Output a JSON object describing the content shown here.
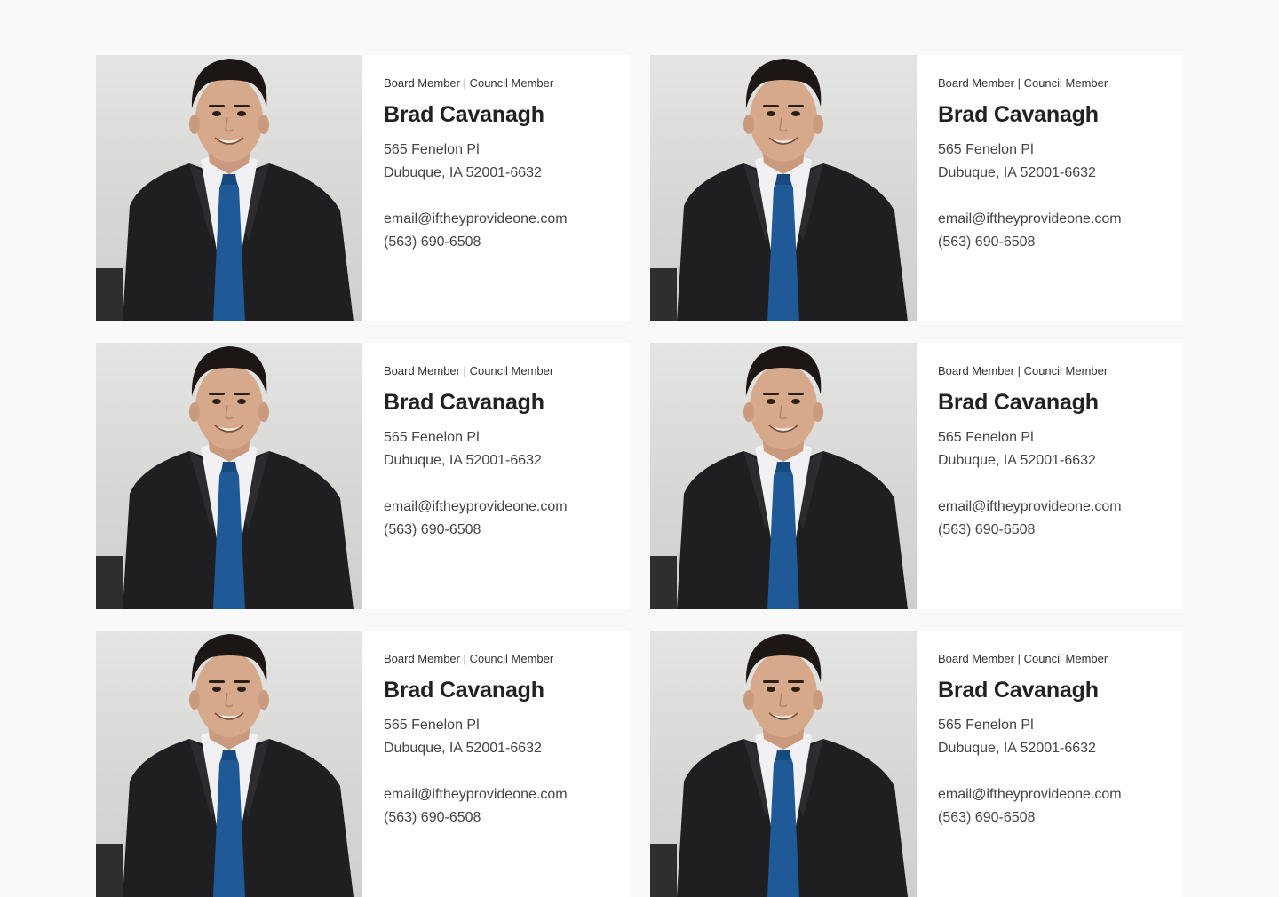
{
  "members": [
    {
      "role": "Board Member | Council Member",
      "name": "Brad Cavanagh",
      "address_line1": "565 Fenelon Pl",
      "address_line2": "Dubuque, IA 52001-6632",
      "email": "email@iftheyprovideone.com",
      "phone": "(563) 690-6508"
    },
    {
      "role": "Board Member | Council Member",
      "name": "Brad Cavanagh",
      "address_line1": "565 Fenelon Pl",
      "address_line2": "Dubuque, IA 52001-6632",
      "email": "email@iftheyprovideone.com",
      "phone": "(563) 690-6508"
    },
    {
      "role": "Board Member | Council Member",
      "name": "Brad Cavanagh",
      "address_line1": "565 Fenelon Pl",
      "address_line2": "Dubuque, IA 52001-6632",
      "email": "email@iftheyprovideone.com",
      "phone": "(563) 690-6508"
    },
    {
      "role": "Board Member | Council Member",
      "name": "Brad Cavanagh",
      "address_line1": "565 Fenelon Pl",
      "address_line2": "Dubuque, IA 52001-6632",
      "email": "email@iftheyprovideone.com",
      "phone": "(563) 690-6508"
    },
    {
      "role": "Board Member | Council Member",
      "name": "Brad Cavanagh",
      "address_line1": "565 Fenelon Pl",
      "address_line2": "Dubuque, IA 52001-6632",
      "email": "email@iftheyprovideone.com",
      "phone": "(563) 690-6508"
    },
    {
      "role": "Board Member | Council Member",
      "name": "Brad Cavanagh",
      "address_line1": "565 Fenelon Pl",
      "address_line2": "Dubuque, IA 52001-6632",
      "email": "email@iftheyprovideone.com",
      "phone": "(563) 690-6508"
    }
  ],
  "colors": {
    "page_background": "#f9f9f9",
    "card_background": "#ffffff",
    "name_text": "#222222",
    "body_text": "#444444"
  }
}
